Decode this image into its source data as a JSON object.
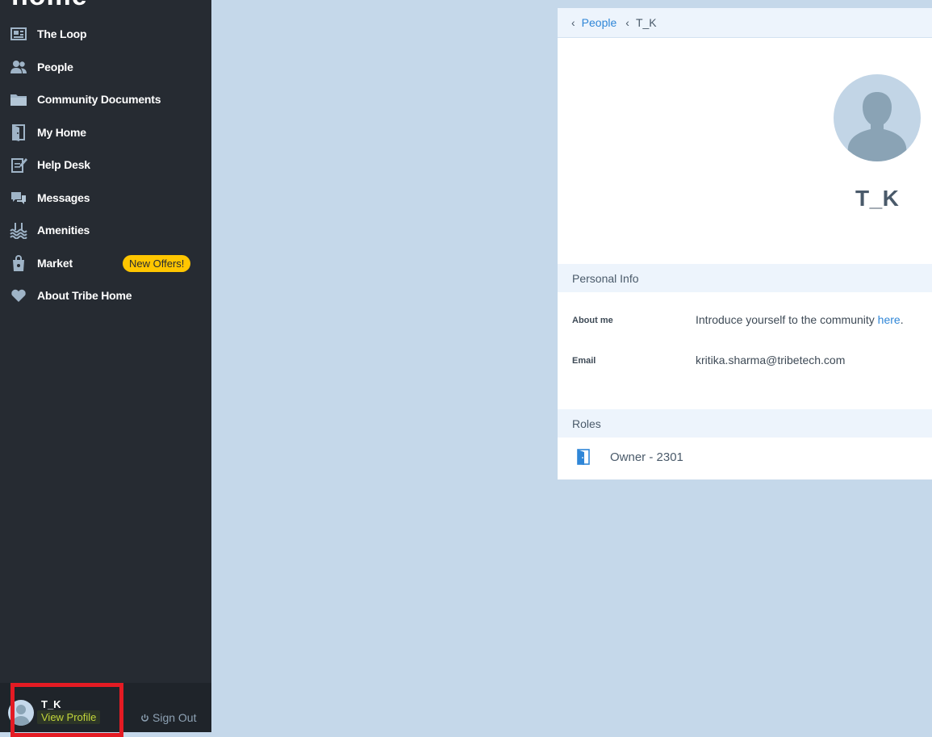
{
  "sidebar": {
    "brand": "home",
    "nav": [
      {
        "label": "The Loop",
        "icon": "newspaper-icon"
      },
      {
        "label": "People",
        "icon": "people-icon"
      },
      {
        "label": "Community Documents",
        "icon": "folder-icon"
      },
      {
        "label": "My Home",
        "icon": "door-icon"
      },
      {
        "label": "Help Desk",
        "icon": "edit-document-icon"
      },
      {
        "label": "Messages",
        "icon": "chat-bubbles-icon"
      },
      {
        "label": "Amenities",
        "icon": "pool-waves-icon"
      },
      {
        "label": "Market",
        "icon": "shopping-bag-icon",
        "badge": "New Offers!"
      },
      {
        "label": "About Tribe Home",
        "icon": "heart-icon"
      }
    ],
    "footer": {
      "user_name": "T_K",
      "view_profile": "View Profile",
      "sign_out": "Sign Out"
    }
  },
  "breadcrumb": {
    "parent": "People",
    "current": "T_K"
  },
  "profile": {
    "name": "T_K",
    "personal_info_title": "Personal Info",
    "about_label": "About me",
    "about_text": "Introduce yourself to the community ",
    "about_link": "here",
    "about_suffix": ".",
    "email_label": "Email",
    "email_value": "kritika.sharma@tribetech.com",
    "roles_title": "Roles",
    "role": "Owner - 2301"
  },
  "colors": {
    "sidebar_bg": "#262b32",
    "page_bg": "#c5d8ea",
    "accent_link": "#2f86d7",
    "badge": "#ffc600",
    "highlight": "#e41b23"
  }
}
